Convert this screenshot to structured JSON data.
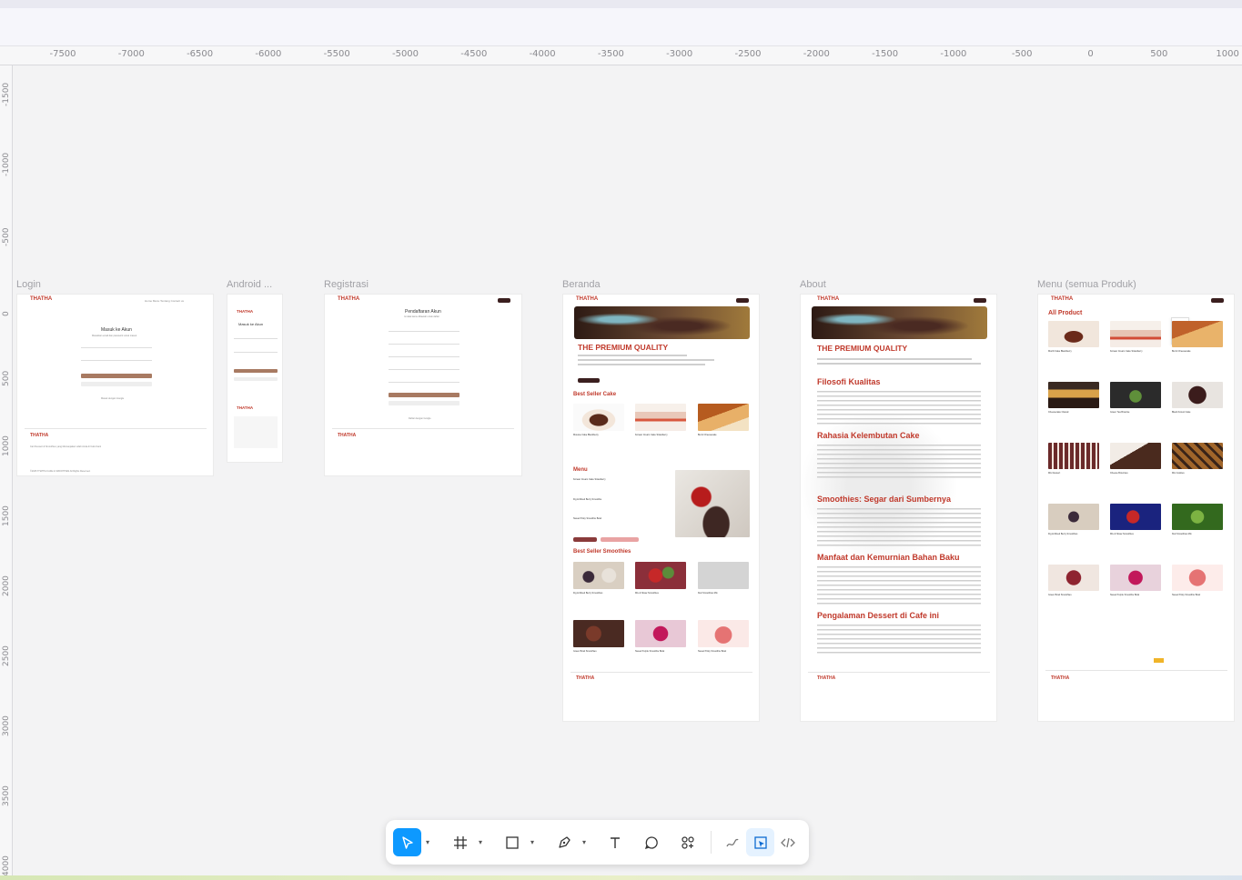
{
  "rulers": {
    "horizontal": [
      "-7500",
      "-7000",
      "-6500",
      "-6000",
      "-5500",
      "-5000",
      "-4500",
      "-4000",
      "-3500",
      "-3000",
      "-2500",
      "-2000",
      "-1500",
      "-1000",
      "-500",
      "0",
      "500",
      "1000"
    ],
    "vertical": [
      "-1500",
      "-1000",
      "-500",
      "0",
      "500",
      "1000",
      "1500",
      "2000",
      "2500",
      "3000",
      "3500",
      "4000"
    ]
  },
  "frames": {
    "login": {
      "label": "Login",
      "logo": "THATHA",
      "nav": "Home  Menu  Tentang  Contact us",
      "title": "Masuk ke Akun",
      "subtitle": "Masukkan email dan password untuk masuk",
      "login_btn": "Masuk",
      "register_btn": "Daftar",
      "google": "Masuk dengan Google",
      "footer_tagline": "Cari Dessert & Smoothies yang Memanjakan Lidah Anda di Cafe Kami",
      "copyright": "©2025 THATHA CAFE & SMOOTHIES All Rights Reserved."
    },
    "android": {
      "label": "Android ...",
      "logo": "THATHA",
      "title": "Masuk ke Akun"
    },
    "registrasi": {
      "label": "Registrasi",
      "logo": "THATHA",
      "title": "Pendaftaran Akun",
      "subtitle": "Isi data kamu dibawah untuk daftar",
      "register_btn": "Daftar",
      "google": "Daftar dengan Google"
    },
    "beranda": {
      "label": "Beranda",
      "logo": "THATHA",
      "hero_title": "THE PREMIUM QUALITY",
      "read_more": "Read More",
      "best_cake": "Best Seller Cake",
      "cakes": [
        "Mousse Cake Blackberry",
        "Korean Cream Cake Strawberry",
        "Burnt Cheesecake"
      ],
      "menu_title": "Menu",
      "menu_items": [
        "Korean Cream Cake Strawberry",
        "Fig & Mixed Berry Smoothie",
        "Sweet Pinky Smoothie Bowl"
      ],
      "best_smoothies": "Best Seller Smoothies",
      "smoothies": [
        "Fig & Mixed Berry Smoothies",
        "Mix & Straw Smoothies",
        "Kiwi Smoothies Mix",
        "Green Bowl Smoothies",
        "Sweet Purple Smoothie Bowl",
        "Sweet Pinky Smoothie Bowl"
      ]
    },
    "about": {
      "label": "About",
      "logo": "THATHA",
      "hero_title": "THE PREMIUM QUALITY",
      "sections": [
        "Filosofi Kualitas",
        "Rahasia Kelembutan Cake",
        "Smoothies: Segar dari Sumbernya",
        "Manfaat dan Kemurnian Bahan Baku",
        "Pengalaman Dessert di Cafe ini"
      ]
    },
    "menu": {
      "label": "Menu (semua Produk)",
      "logo": "THATHA",
      "heading": "All Product",
      "products": [
        "Mochi Cake Blackberry",
        "Korean Cream Cake Strawberry",
        "Burnt Cheesecake",
        "Cheesecake Classic",
        "Green Tea Brownie",
        "Black Forest Cake",
        "Mix Dessert",
        "Cheese Brownies",
        "Mix Cookies",
        "Fig & Mixed Berry Smoothies",
        "Mix & Straw Smoothies",
        "Kiwi Smoothies Mix",
        "Green Bowl Smoothies",
        "Sweet Purple Smoothie Bowl",
        "Sweet Pinky Smoothie Bowl"
      ]
    }
  },
  "toolbar": {
    "move": "move-tool",
    "frame": "frame-tool",
    "shape": "rectangle-tool",
    "pen": "pen-tool",
    "text": "text-tool",
    "comment": "comment-tool",
    "assets": "assets-tool",
    "draw": "draw-mode",
    "design": "design-mode",
    "dev": "dev-mode",
    "accent": "#0d99ff"
  }
}
